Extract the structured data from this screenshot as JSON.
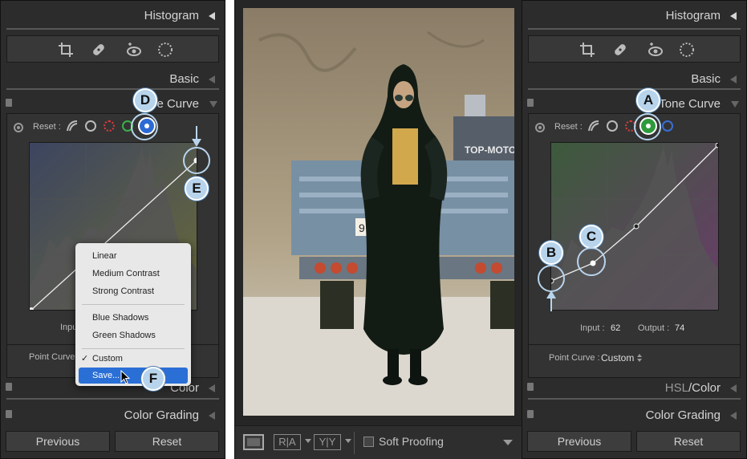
{
  "left": {
    "histogram": "Histogram",
    "basic": "Basic",
    "tone_curve": "e Curve",
    "reset": "Reset :",
    "input_partial": "Inpu",
    "point_curve_label": "Point Curve :",
    "color_partial": "Color",
    "color_grading": "Color Grading",
    "menu": {
      "linear": "Linear",
      "medium": "Medium Contrast",
      "strong": "Strong Contrast",
      "blue_shadows": "Blue Shadows",
      "green_shadows": "Green Shadows",
      "checkmark": "✓",
      "custom": "Custom",
      "save": "Save..."
    },
    "prev": "Previous",
    "reset_btn": "Reset",
    "callouts": {
      "d": "D",
      "e": "E",
      "f": "F"
    }
  },
  "right": {
    "histogram": "Histogram",
    "basic": "Basic",
    "tone_curve": "Tone Curve",
    "reset": "Reset :",
    "input_label": "Input :",
    "input_value": "62",
    "output_label": "Output :",
    "output_value": "74",
    "point_curve_label": "Point Curve :",
    "point_curve_value": "Custom",
    "hsl_a": "HSL",
    "hsl_sep": "/",
    "hsl_b": "Color",
    "color_grading": "Color Grading",
    "prev": "Previous",
    "reset_btn": "Reset",
    "callouts": {
      "a": "A",
      "b": "B",
      "c": "C"
    }
  },
  "center": {
    "ra": "R|A",
    "yy": "Y|Y",
    "soft_proofing": "Soft Proofing",
    "truck_sign": "TOP-MOTO",
    "plate": "9"
  }
}
